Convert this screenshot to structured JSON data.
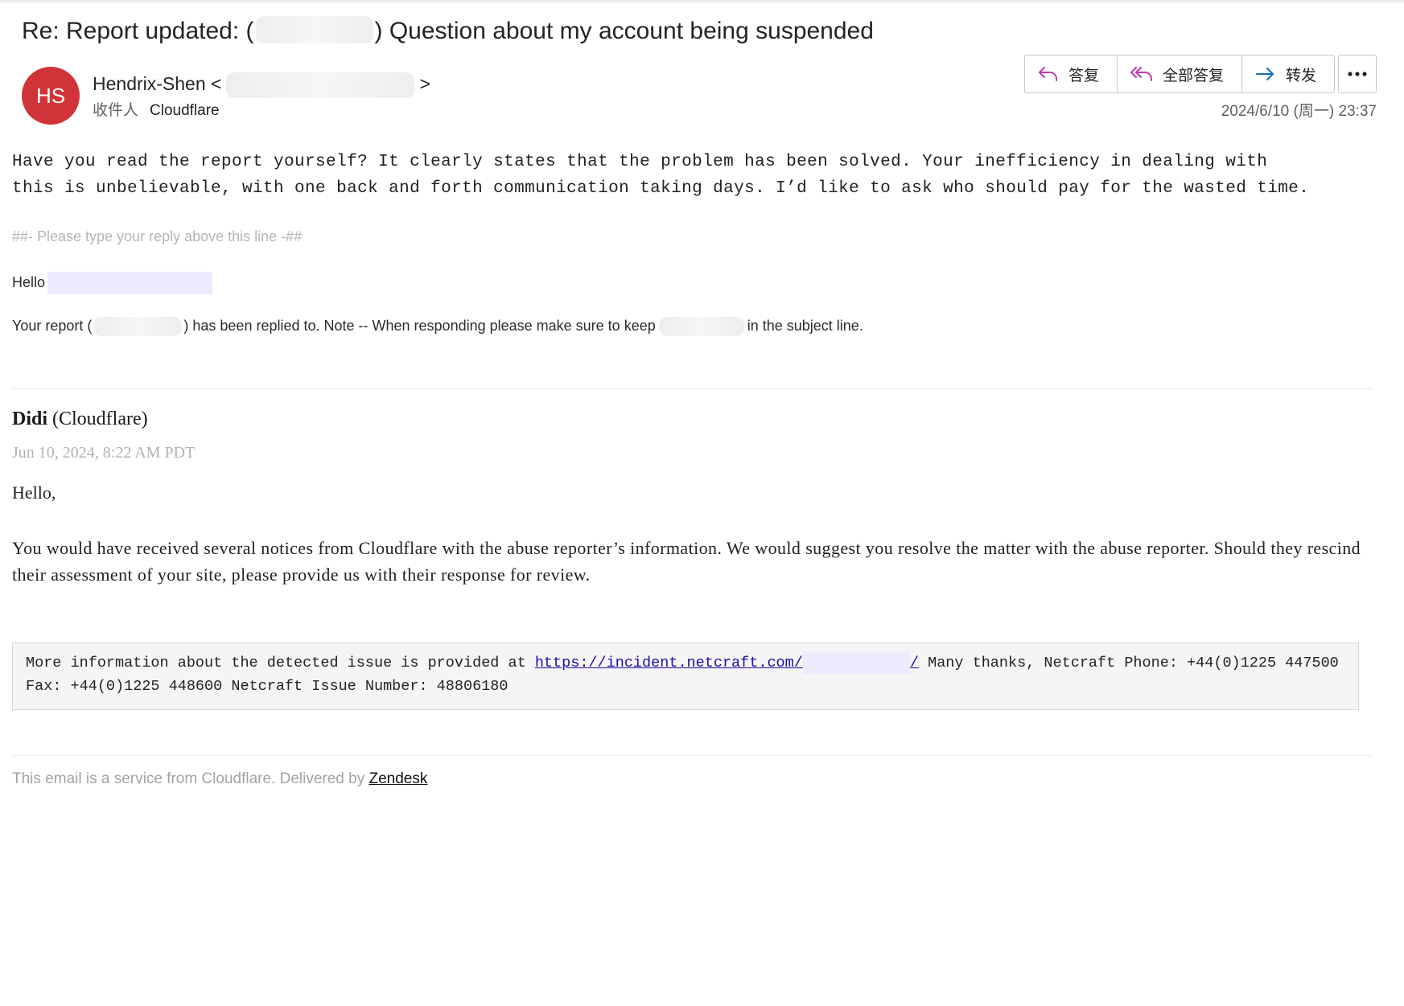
{
  "header": {
    "subject_prefix": "Re: Report updated: (",
    "subject_suffix": ") Question about my account being suspended",
    "avatar_initials": "HS",
    "avatar_color": "#d13438",
    "sender_name": "Hendrix-Shen",
    "sender_open": "<",
    "sender_close": ">",
    "to_label": "收件人",
    "to_name": "Cloudflare",
    "date": "2024/6/10 (周一) 23:37"
  },
  "actions": {
    "reply": "答复",
    "reply_all": "全部答复",
    "forward": "转发",
    "more_icon": "more-horizontal-icon",
    "reply_icon_color": "#c239b3",
    "forward_icon_color": "#0f6cbd"
  },
  "message": {
    "body": "Have you read the report yourself? It clearly states that the problem has been solved. Your inefficiency in dealing with this is unbelievable, with one back and forth communication taking days. I’d like to ask who should pay for the wasted time.",
    "reply_marker": "##- Please type your reply above this line -##",
    "hello": "Hello",
    "report_prefix": "Your report (",
    "report_middle": ") has been replied to. Note -- When responding please make sure to keep",
    "report_suffix": "in the subject line."
  },
  "quoted": {
    "agent_name": "Didi",
    "agent_org": "(Cloudflare)",
    "agent_date": "Jun 10, 2024, 8:22 AM PDT",
    "greeting": "Hello,",
    "body": "You would have received several notices from Cloudflare with the abuse reporter’s information. We would suggest you resolve the matter with the abuse reporter. Should they rescind their assessment of your site, please provide us with their response for review.",
    "info_prefix": "More information about the detected issue is provided at ",
    "info_link": "https://incident.netcraft.com/",
    "info_link_end": "/",
    "info_rest": " Many thanks, Netcraft Phone: +44(0)1225 447500",
    "info_line2": "Fax: +44(0)1225 448600 Netcraft Issue Number: 48806180"
  },
  "footer": {
    "text": "This email is a service from Cloudflare. Delivered by ",
    "link": "Zendesk"
  }
}
